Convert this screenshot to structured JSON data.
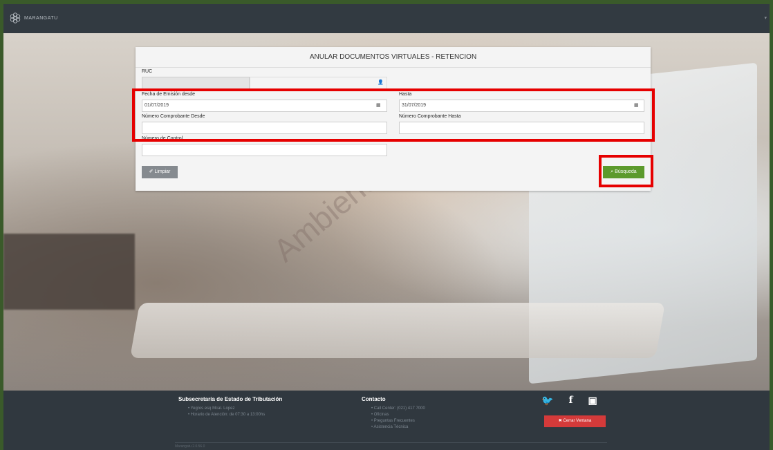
{
  "app": {
    "brand": "MARANGATU"
  },
  "form": {
    "title": "ANULAR DOCUMENTOS VIRTUALES - RETENCION",
    "ruc_label": "RUC",
    "ruc_value": "",
    "fecha_desde_label": "Fecha de Emisión desde",
    "fecha_desde_value": "01/07/2019",
    "fecha_hasta_label": "Hasta",
    "fecha_hasta_value": "31/07/2019",
    "comp_desde_label": "Número Comprobante Desde",
    "comp_desde_value": "",
    "comp_hasta_label": "Número Comprobante Hasta",
    "comp_hasta_value": "",
    "control_label": "Número de Control",
    "control_value": "",
    "limpiar_label": "Limpiar",
    "busqueda_label": "Búsqueda"
  },
  "watermark": "Ambiente de Pruebas",
  "footer": {
    "col1_title": "Subsecretaría de Estado de Tributación",
    "col1_items": [
      "Yegros esq Mcal. Lopez",
      "Horario de Atención: de 07:30 a 13:00hs"
    ],
    "col2_title": "Contacto",
    "col2_items": [
      "Call Center: (021) 417 7000",
      "Oficinas",
      "Preguntas Frecuentes",
      "Asistencia Técnica"
    ],
    "close_label": "Cerrar Ventana",
    "version": "Marangatu 2.0.56.0"
  },
  "colors": {
    "highlight": "#e60000",
    "primary": "#5c9a2c",
    "danger": "#d43a3a"
  }
}
